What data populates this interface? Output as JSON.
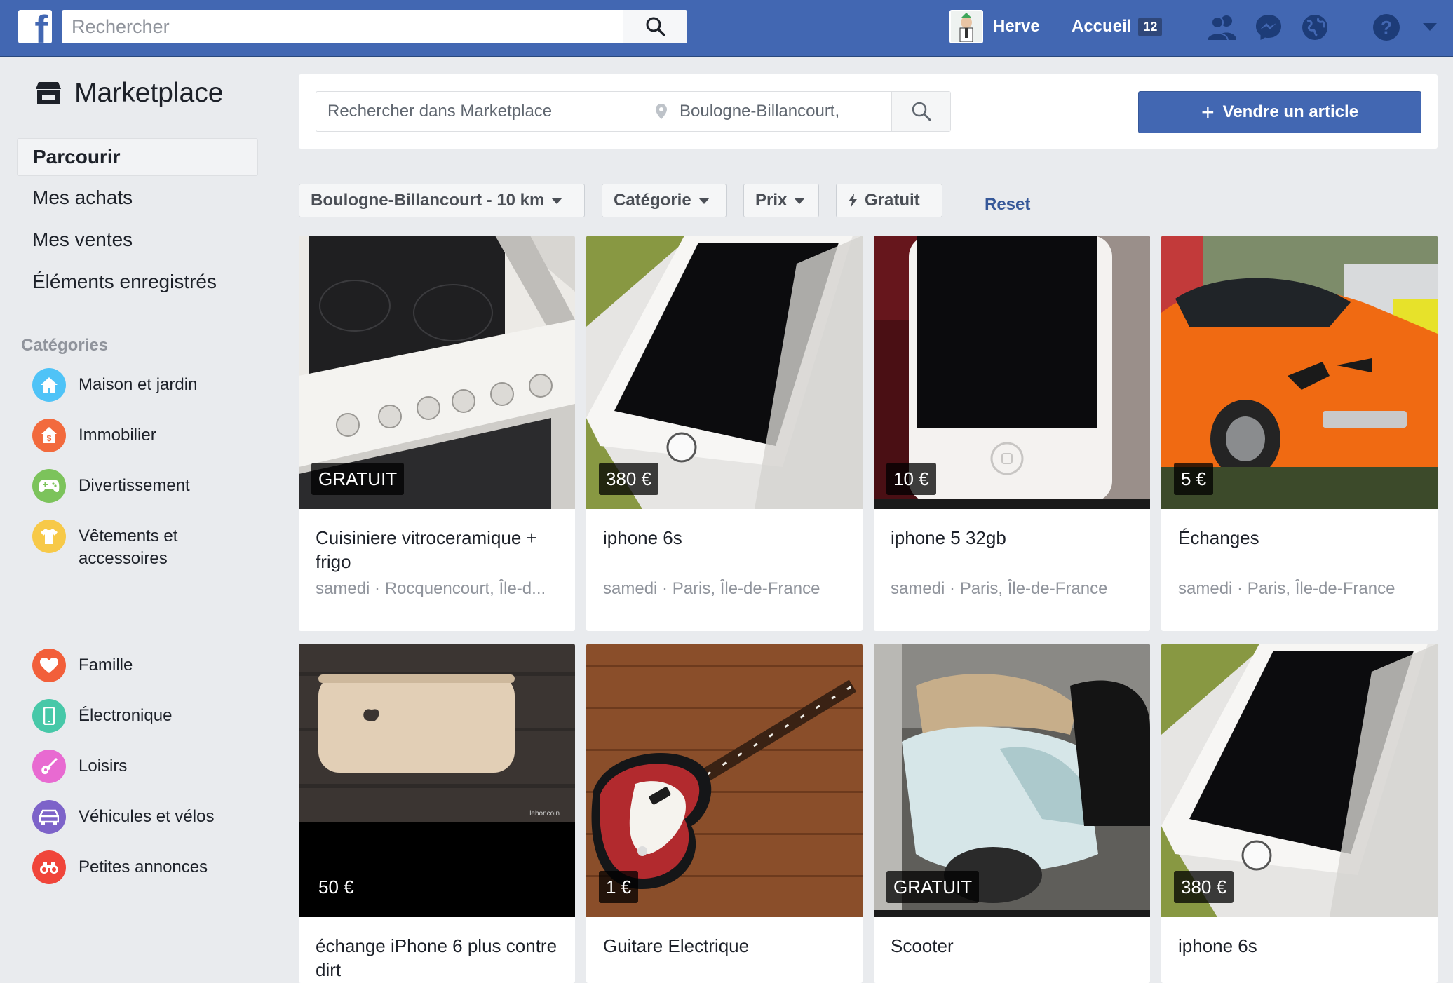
{
  "topbar": {
    "search_placeholder": "Rechercher",
    "user_name": "Herve",
    "home_label": "Accueil",
    "home_badge": "12",
    "brand_color": "#4267b2"
  },
  "sidebar": {
    "title": "Marketplace",
    "nav": [
      {
        "label": "Parcourir",
        "active": true
      },
      {
        "label": "Mes achats"
      },
      {
        "label": "Mes ventes"
      },
      {
        "label": "Éléments enregistrés"
      }
    ],
    "categories_heading": "Catégories",
    "categories": [
      {
        "label": "Maison et jardin",
        "icon": "house-icon",
        "color": "#4fc3f7"
      },
      {
        "label": "Immobilier",
        "icon": "real-estate-icon",
        "color": "#f26a3d"
      },
      {
        "label": "Divertissement",
        "icon": "gamepad-icon",
        "color": "#7cc35b"
      },
      {
        "label": "Vêtements et accessoires",
        "icon": "tshirt-icon",
        "color": "#f7c948"
      },
      {
        "label": "Famille",
        "icon": "heart-icon",
        "color": "#f25f3a"
      },
      {
        "label": "Électronique",
        "icon": "phone-icon",
        "color": "#47c8a8"
      },
      {
        "label": "Loisirs",
        "icon": "guitar-icon",
        "color": "#e86ad1"
      },
      {
        "label": "Véhicules et vélos",
        "icon": "car-icon",
        "color": "#7d63c9"
      },
      {
        "label": "Petites annonces",
        "icon": "binoculars-icon",
        "color": "#f0453a"
      }
    ]
  },
  "search": {
    "placeholder": "Rechercher dans Marketplace",
    "location": "Boulogne-Billancourt,",
    "sell_label": "Vendre un article"
  },
  "filters": {
    "location": "Boulogne-Billancourt - 10 km",
    "category": "Catégorie",
    "price": "Prix",
    "free": "Gratuit",
    "reset": "Reset"
  },
  "listings": [
    {
      "price": "GRATUIT",
      "title": "Cuisiniere vitroceramique + frigo",
      "meta": "samedi · Rocquencourt, Île-d..."
    },
    {
      "price": "380 €",
      "title": "iphone 6s",
      "meta": "samedi · Paris, Île-de-France"
    },
    {
      "price": "10 €",
      "title": "iphone 5 32gb",
      "meta": "samedi · Paris, Île-de-France"
    },
    {
      "price": "5 €",
      "title": "Échanges",
      "meta": "samedi · Paris, Île-de-France"
    },
    {
      "price": "50 €",
      "title": "échange iPhone 6 plus contre dirt",
      "meta": ""
    },
    {
      "price": "1 €",
      "title": "Guitare Electrique",
      "meta": ""
    },
    {
      "price": "GRATUIT",
      "title": "Scooter",
      "meta": ""
    },
    {
      "price": "380 €",
      "title": "iphone 6s",
      "meta": ""
    }
  ]
}
